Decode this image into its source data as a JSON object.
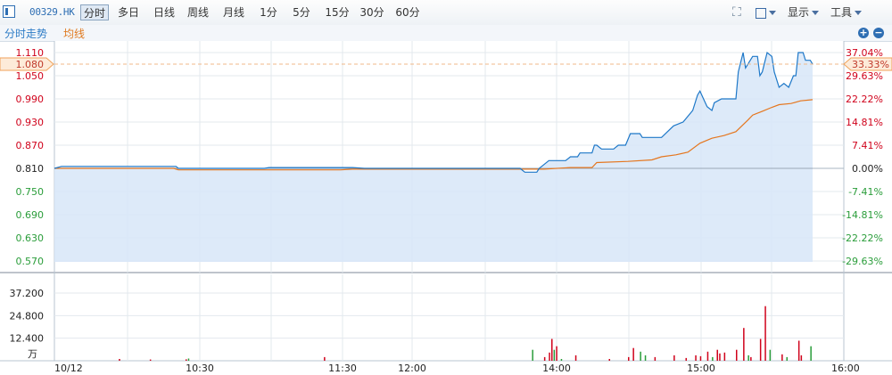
{
  "toolbar": {
    "symbol": "00329.HK",
    "periods": [
      {
        "label": "分时",
        "active": true
      },
      {
        "label": "多日"
      },
      {
        "label": "日线"
      },
      {
        "label": "周线"
      },
      {
        "label": "月线"
      },
      {
        "label": "1分"
      },
      {
        "label": "5分"
      },
      {
        "label": "15分"
      },
      {
        "label": "30分"
      },
      {
        "label": "60分"
      }
    ],
    "display_label": "显示",
    "tools_label": "工具"
  },
  "subheader": {
    "series_label": "分时走势",
    "avg_label": "均线",
    "zoom_in": "+",
    "zoom_out": "−"
  },
  "colors": {
    "price_line": "#1e78c8",
    "avg_line": "#e5761e",
    "fill": "#d7e6f8",
    "up": "#d0021b",
    "down": "#2a9d3a",
    "neutral": "#222222"
  },
  "chart_data": {
    "type": "line",
    "prev_close": 0.81,
    "price_ticks": [
      "1.110",
      "1.080",
      "1.050",
      "0.990",
      "0.930",
      "0.870",
      "0.810",
      "0.750",
      "0.690",
      "0.630",
      "0.570"
    ],
    "pct_ticks": [
      "37.04%",
      "33.33%",
      "29.63%",
      "22.22%",
      "14.81%",
      "7.41%",
      "0.00%",
      "-7.41%",
      "-14.81%",
      "-22.22%",
      "-29.63%"
    ],
    "current_price": "1.080",
    "current_pct": "33.33%",
    "volume_ticks": [
      "37.200",
      "24.800",
      "12.400"
    ],
    "volume_unit": "万",
    "x_labels": [
      "10/12",
      "10:30",
      "11:30",
      "12:00",
      "14:00",
      "15:00",
      "16:00"
    ],
    "price_series": [
      [
        "09:30",
        0.81
      ],
      [
        "09:33",
        0.815
      ],
      [
        "10:21",
        0.815
      ],
      [
        "10:22",
        0.81
      ],
      [
        "10:58",
        0.81
      ],
      [
        "11:00",
        0.812
      ],
      [
        "11:35",
        0.812
      ],
      [
        "11:40",
        0.81
      ],
      [
        "13:45",
        0.81
      ],
      [
        "13:47",
        0.8
      ],
      [
        "13:52",
        0.8
      ],
      [
        "13:53",
        0.81
      ],
      [
        "13:55",
        0.82
      ],
      [
        "13:57",
        0.83
      ],
      [
        "14:00",
        0.83
      ],
      [
        "14:04",
        0.83
      ],
      [
        "14:06",
        0.84
      ],
      [
        "14:09",
        0.84
      ],
      [
        "14:10",
        0.85
      ],
      [
        "14:15",
        0.85
      ],
      [
        "14:16",
        0.87
      ],
      [
        "14:17",
        0.87
      ],
      [
        "14:19",
        0.86
      ],
      [
        "14:24",
        0.86
      ],
      [
        "14:26",
        0.87
      ],
      [
        "14:29",
        0.87
      ],
      [
        "14:31",
        0.9
      ],
      [
        "14:35",
        0.9
      ],
      [
        "14:36",
        0.89
      ],
      [
        "14:44",
        0.89
      ],
      [
        "14:49",
        0.92
      ],
      [
        "14:53",
        0.93
      ],
      [
        "14:57",
        0.96
      ],
      [
        "14:59",
        1.0
      ],
      [
        "15:00",
        1.01
      ],
      [
        "15:03",
        0.97
      ],
      [
        "15:05",
        0.96
      ],
      [
        "15:06",
        0.98
      ],
      [
        "15:09",
        0.99
      ],
      [
        "15:12",
        0.99
      ],
      [
        "15:15",
        0.99
      ],
      [
        "15:16",
        1.06
      ],
      [
        "15:18",
        1.11
      ],
      [
        "15:19",
        1.07
      ],
      [
        "15:22",
        1.1
      ],
      [
        "15:24",
        1.1
      ],
      [
        "15:25",
        1.05
      ],
      [
        "15:26",
        1.06
      ],
      [
        "15:28",
        1.11
      ],
      [
        "15:30",
        1.1
      ],
      [
        "15:31",
        1.06
      ],
      [
        "15:33",
        1.02
      ],
      [
        "15:35",
        1.03
      ],
      [
        "15:37",
        1.02
      ],
      [
        "15:39",
        1.05
      ],
      [
        "15:40",
        1.05
      ],
      [
        "15:41",
        1.11
      ],
      [
        "15:43",
        1.11
      ],
      [
        "15:44",
        1.09
      ],
      [
        "15:46",
        1.09
      ],
      [
        "15:47",
        1.08
      ]
    ],
    "avg_series": [
      [
        "09:30",
        0.81
      ],
      [
        "10:20",
        0.81
      ],
      [
        "10:22",
        0.806
      ],
      [
        "11:30",
        0.806
      ],
      [
        "11:35",
        0.808
      ],
      [
        "13:00",
        0.808
      ],
      [
        "13:55",
        0.808
      ],
      [
        "14:06",
        0.812
      ],
      [
        "14:15",
        0.812
      ],
      [
        "14:17",
        0.825
      ],
      [
        "14:30",
        0.828
      ],
      [
        "14:40",
        0.832
      ],
      [
        "14:44",
        0.84
      ],
      [
        "14:50",
        0.845
      ],
      [
        "14:55",
        0.852
      ],
      [
        "15:00",
        0.875
      ],
      [
        "15:05",
        0.888
      ],
      [
        "15:10",
        0.895
      ],
      [
        "15:15",
        0.905
      ],
      [
        "15:20",
        0.935
      ],
      [
        "15:22",
        0.948
      ],
      [
        "15:26",
        0.958
      ],
      [
        "15:30",
        0.968
      ],
      [
        "15:33",
        0.975
      ],
      [
        "15:38",
        0.978
      ],
      [
        "15:42",
        0.985
      ],
      [
        "15:47",
        0.988
      ]
    ],
    "volume_bars": [
      [
        "09:57",
        1.0,
        "up"
      ],
      [
        "10:10",
        0.7,
        "up"
      ],
      [
        "10:25",
        0.8,
        "up"
      ],
      [
        "10:26",
        1.2,
        "down"
      ],
      [
        "11:23",
        2.0,
        "up"
      ],
      [
        "13:50",
        6.0,
        "down"
      ],
      [
        "13:55",
        2.0,
        "up"
      ],
      [
        "13:57",
        4.5,
        "up"
      ],
      [
        "13:58",
        12.0,
        "up"
      ],
      [
        "13:59",
        6.0,
        "down"
      ],
      [
        "14:00",
        8.0,
        "up"
      ],
      [
        "14:02",
        1.0,
        "down"
      ],
      [
        "14:08",
        3.0,
        "up"
      ],
      [
        "14:22",
        1.0,
        "up"
      ],
      [
        "14:30",
        2.0,
        "up"
      ],
      [
        "14:32",
        7.0,
        "up"
      ],
      [
        "14:35",
        5.0,
        "down"
      ],
      [
        "14:37",
        3.0,
        "down"
      ],
      [
        "14:41",
        2.0,
        "up"
      ],
      [
        "14:49",
        3.0,
        "up"
      ],
      [
        "14:54",
        1.5,
        "up"
      ],
      [
        "14:58",
        3.0,
        "up"
      ],
      [
        "15:00",
        2.5,
        "up"
      ],
      [
        "15:03",
        5.0,
        "up"
      ],
      [
        "15:05",
        2.0,
        "down"
      ],
      [
        "15:07",
        6.0,
        "up"
      ],
      [
        "15:08",
        4.0,
        "up"
      ],
      [
        "15:10",
        4.5,
        "up"
      ],
      [
        "15:15",
        6.0,
        "up"
      ],
      [
        "15:18",
        18.0,
        "up"
      ],
      [
        "15:20",
        3.0,
        "down"
      ],
      [
        "15:21",
        2.0,
        "up"
      ],
      [
        "15:25",
        12.0,
        "up"
      ],
      [
        "15:27",
        30.0,
        "up"
      ],
      [
        "15:29",
        6.0,
        "down"
      ],
      [
        "15:34",
        3.5,
        "up"
      ],
      [
        "15:36",
        2.0,
        "down"
      ],
      [
        "15:41",
        11.0,
        "up"
      ],
      [
        "15:42",
        3.0,
        "up"
      ],
      [
        "15:46",
        8.0,
        "down"
      ]
    ]
  }
}
